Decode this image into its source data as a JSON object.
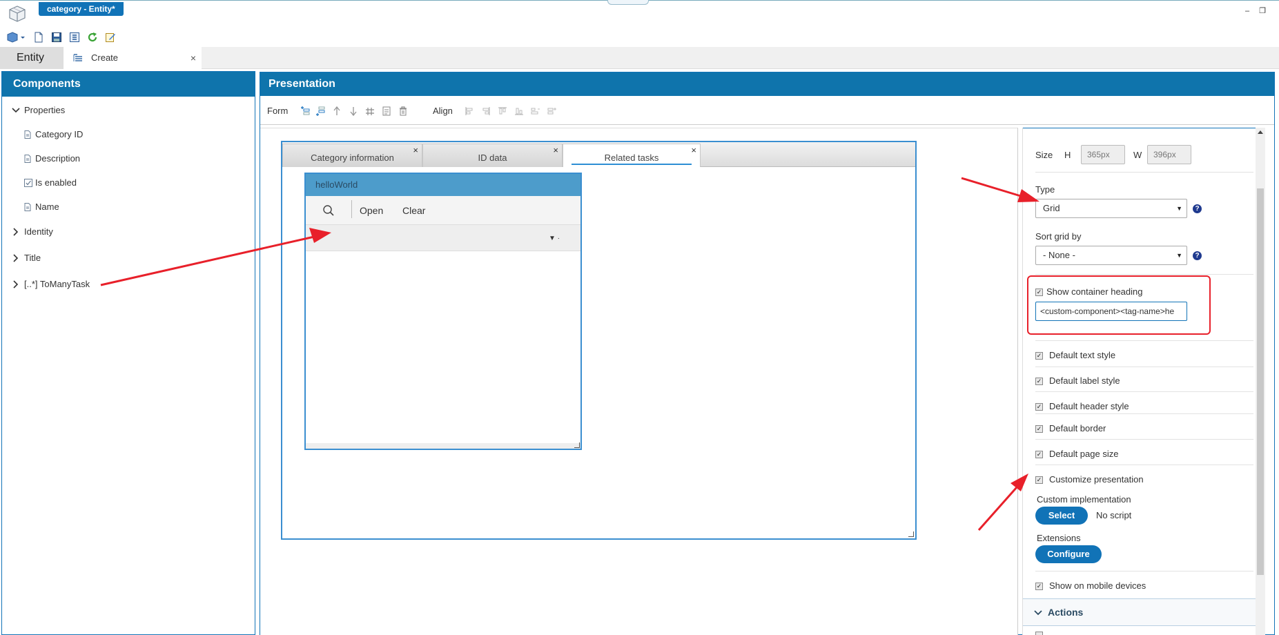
{
  "window": {
    "title": "category - Entity*",
    "minimize_glyph": "–",
    "restore_glyph": "❐"
  },
  "quick_toolbar": {
    "icons": [
      "cube-dropdown-icon",
      "new-document-icon",
      "save-icon",
      "save-all-icon",
      "refresh-icon",
      "edit-icon"
    ]
  },
  "tabs": {
    "entity_label": "Entity",
    "create_label": "Create",
    "close_glyph": "×"
  },
  "components": {
    "title": "Components",
    "tree": [
      {
        "label": "Properties",
        "expanded": true,
        "type": "folder"
      },
      {
        "label": "Category ID",
        "type": "field"
      },
      {
        "label": "Description",
        "type": "field"
      },
      {
        "label": "Is enabled",
        "type": "checkbox-field"
      },
      {
        "label": "Name",
        "type": "field"
      },
      {
        "label": "Identity",
        "expanded": false,
        "type": "folder"
      },
      {
        "label": "Title",
        "expanded": false,
        "type": "folder"
      },
      {
        "label": "[..*] ToManyTask",
        "expanded": false,
        "type": "folder"
      }
    ]
  },
  "presentation": {
    "title": "Presentation",
    "toolbar": {
      "form_label": "Form",
      "align_label": "Align"
    },
    "form_tabs": [
      {
        "label": "Category information",
        "active": false
      },
      {
        "label": "ID data",
        "active": false
      },
      {
        "label": "Related tasks",
        "active": true
      }
    ],
    "grid": {
      "title": "helloWorld",
      "open_label": "Open",
      "clear_label": "Clear"
    }
  },
  "properties": {
    "size_label": "Size",
    "h_label": "H",
    "h_value": "365px",
    "w_label": "W",
    "w_value": "396px",
    "type_label": "Type",
    "type_value": "Grid",
    "sort_label": "Sort grid by",
    "sort_value": "- None -",
    "help_glyph": "?",
    "show_heading_label": "Show container heading",
    "show_heading_checked": true,
    "heading_value": "<custom-component><tag-name>he",
    "checkboxes": [
      {
        "label": "Default text style",
        "checked": true
      },
      {
        "label": "Default label style",
        "checked": true
      },
      {
        "label": "Default header style",
        "checked": true
      },
      {
        "label": "Default border",
        "checked": true
      },
      {
        "label": "Default page size",
        "checked": true
      },
      {
        "label": "Customize presentation",
        "checked": true
      }
    ],
    "custom_impl_label": "Custom implementation",
    "select_button": "Select",
    "no_script_label": "No script",
    "extensions_label": "Extensions",
    "configure_button": "Configure",
    "mobile_label": "Show on mobile devices",
    "mobile_checked": true,
    "actions_label": "Actions"
  },
  "colors": {
    "brand_blue": "#0f74ac",
    "accent_blue": "#1173b7",
    "annotation_red": "#e8202a"
  }
}
